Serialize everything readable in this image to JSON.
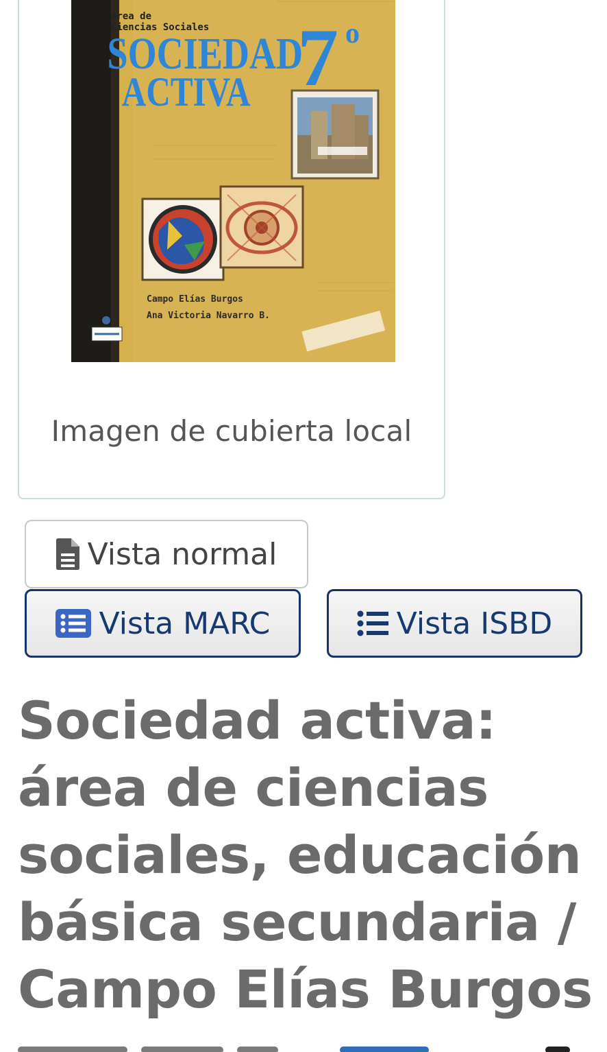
{
  "cover": {
    "caption": "Imagen de cubierta local",
    "image_text": {
      "area": "Area de",
      "subject": "Ciencias Sociales",
      "title_line1": "SOCIEDAD",
      "title_line2": "ACTIVA",
      "grade": "7",
      "grade_sup": "o",
      "author1": "Campo Elías Burgos",
      "author2": "Ana Victoria Navarro B."
    }
  },
  "views": {
    "normal_label": "Vista normal",
    "marc_label": "Vista MARC",
    "isbd_label": "Vista ISBD"
  },
  "record": {
    "title": "Sociedad activa: área de ciencias sociales, educación básica secundaria / Campo Elías Burgos"
  },
  "colors": {
    "button_border_active": "#16336b",
    "button_text_active": "#163a70",
    "title_color": "#6b6b6b",
    "card_border": "#c9dede",
    "cover_bg": "#d6ae4a",
    "cover_title_blue": "#2f86d6"
  }
}
